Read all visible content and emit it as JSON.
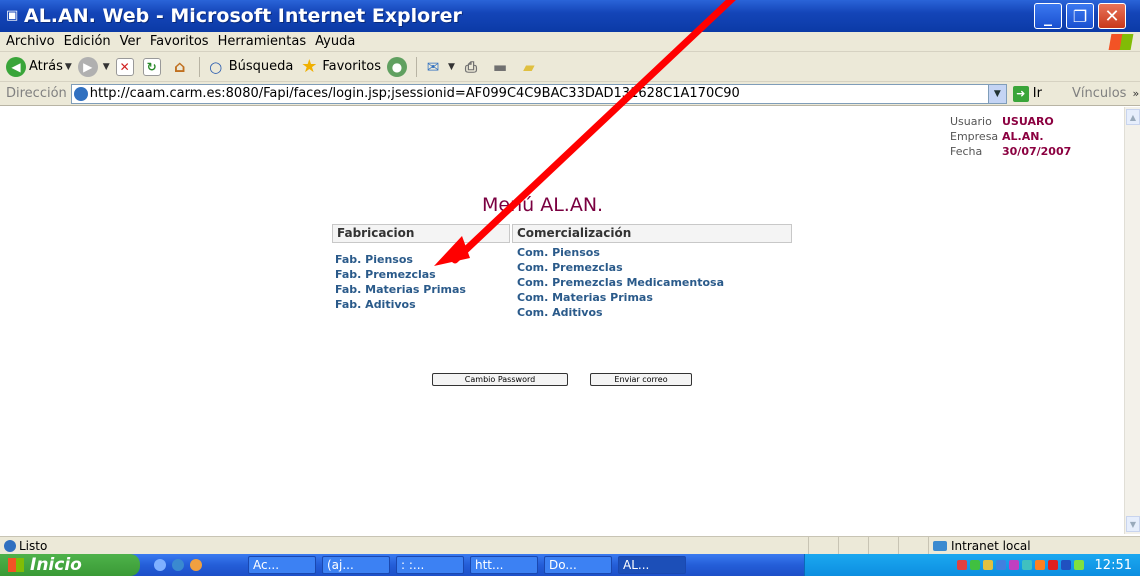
{
  "window": {
    "title": "AL.AN. Web - Microsoft Internet Explorer",
    "minimize": "_",
    "maximize": "❐",
    "close": "✕"
  },
  "menu": [
    "Archivo",
    "Edición",
    "Ver",
    "Favoritos",
    "Herramientas",
    "Ayuda"
  ],
  "toolbar": {
    "back_label": "Atrás",
    "search_label": "Búsqueda",
    "favorites_label": "Favoritos"
  },
  "address": {
    "label": "Dirección",
    "url": "http://caam.carm.es:8080/Fapi/faces/login.jsp;jsessionid=AF099C4C9BAC33DAD131628C1A170C90",
    "go_label": "Ir",
    "links_label": "Vínculos"
  },
  "userinfo": {
    "usuario_label": "Usuario",
    "usuario_value": "USUARO",
    "empresa_label": "Empresa",
    "empresa_value": "AL.AN.",
    "fecha_label": "Fecha",
    "fecha_value": "30/07/2007"
  },
  "page": {
    "title": "Menú AL.AN.",
    "fabricacion_header": "Fabricacion",
    "comercializacion_header": "Comercialización",
    "fab_links": [
      "Fab. Piensos",
      "Fab. Premezclas",
      "Fab. Materias Primas",
      "Fab. Aditivos"
    ],
    "com_links": [
      "Com. Piensos",
      "Com. Premezclas",
      "Com. Premezclas Medicamentosa",
      "Com. Materias Primas",
      "Com. Aditivos"
    ],
    "change_password_label": "Cambio Password",
    "send_mail_label": "Enviar correo"
  },
  "status": {
    "text": "Listo",
    "zone": "Intranet local"
  },
  "taskbar": {
    "start_label": "Inicio",
    "tasks": [
      "Ac...",
      "(aj...",
      ": :...",
      "htt...",
      "Do...",
      "AL..."
    ],
    "clock": "12:51"
  },
  "colors": {
    "annotation_arrow": "#ff0000",
    "menu_title": "#7a0040",
    "link": "#2a5a8a"
  }
}
